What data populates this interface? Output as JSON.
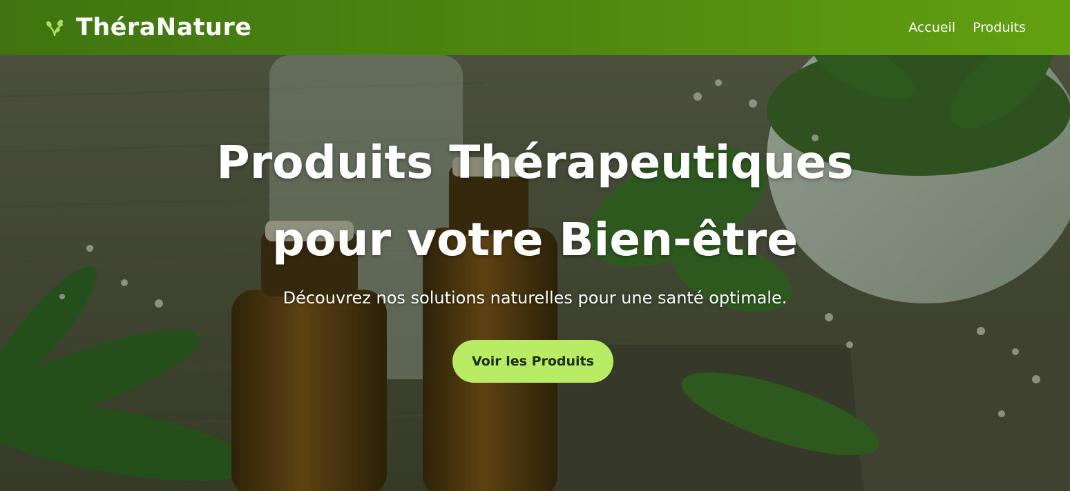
{
  "header": {
    "brand_name": "ThéraNature",
    "brand_icon": "leaf-icon",
    "nav": [
      {
        "label": "Accueil"
      },
      {
        "label": "Produits"
      }
    ]
  },
  "hero": {
    "title_line1": "Produits Thérapeutiques",
    "title_line2": "pour votre Bien-être",
    "subtitle": "Découvrez nos solutions naturelles pour une santé optimale.",
    "cta_label": "Voir les Produits"
  },
  "colors": {
    "navbar": "#4e8a0f",
    "accent": "#b8ec64",
    "brand_icon": "#a8e05a"
  }
}
